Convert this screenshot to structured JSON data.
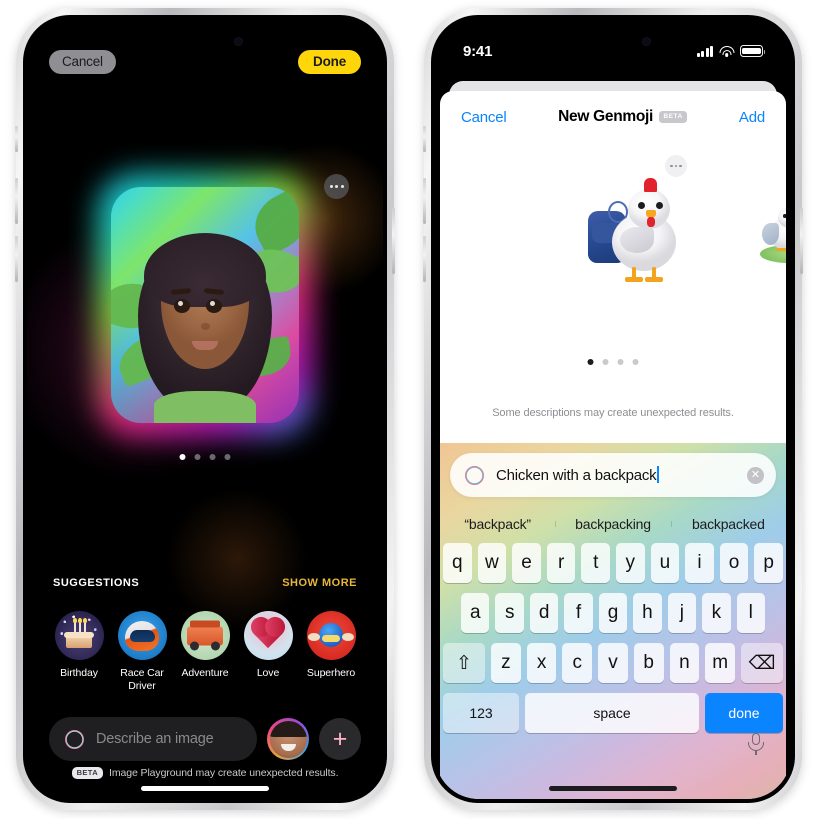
{
  "left_phone": {
    "app": "Image Playground",
    "topbar": {
      "cancel_label": "Cancel",
      "done_label": "Done"
    },
    "more_options_icon": "ellipsis-icon",
    "carousel": {
      "pages": 4,
      "active_index": 0
    },
    "suggestions": {
      "header_label": "SUGGESTIONS",
      "show_more_label": "SHOW MORE",
      "items": [
        {
          "label": "Birthday",
          "icon": "birthday-cake-icon"
        },
        {
          "label": "Race Car Driver",
          "icon": "racing-helmet-icon"
        },
        {
          "label": "Adventure",
          "icon": "offroad-truck-icon"
        },
        {
          "label": "Love",
          "icon": "heart-icon"
        },
        {
          "label": "Superhero",
          "icon": "superhero-icon"
        }
      ]
    },
    "compose": {
      "placeholder": "Describe an image",
      "value": "",
      "sparkle_icon": "image-playground-icon",
      "avatar_icon": "person-avatar",
      "add_label": "+"
    },
    "footer": {
      "beta_badge": "BETA",
      "disclaimer": "Image Playground may create unexpected results."
    }
  },
  "right_phone": {
    "statusbar": {
      "time": "9:41",
      "cellular_icon": "signal-bars-icon",
      "wifi_icon": "wifi-icon",
      "battery_icon": "battery-icon"
    },
    "nav": {
      "cancel_label": "Cancel",
      "title": "New Genmoji",
      "beta_badge": "BETA",
      "add_label": "Add"
    },
    "canvas": {
      "more_options_icon": "ellipsis-icon",
      "main_result_icon": "chicken-with-backpack-genmoji",
      "next_result_icon": "chicken-on-grass-genmoji",
      "pages": 4,
      "active_index": 0
    },
    "hint": "Some descriptions may create unexpected results.",
    "input": {
      "sparkle_icon": "genmoji-icon",
      "value": "Chicken with a backpack",
      "clear_icon": "clear-text-icon"
    },
    "predictions": [
      "“backpack”",
      "backpacking",
      "backpacked"
    ],
    "keyboard": {
      "row1": [
        "q",
        "w",
        "e",
        "r",
        "t",
        "y",
        "u",
        "i",
        "o",
        "p"
      ],
      "row2": [
        "a",
        "s",
        "d",
        "f",
        "g",
        "h",
        "j",
        "k",
        "l"
      ],
      "row3_shift": "⇧",
      "row3": [
        "z",
        "x",
        "c",
        "v",
        "b",
        "n",
        "m"
      ],
      "row3_delete": "⌫",
      "numbers_label": "123",
      "space_label": "space",
      "done_label": "done",
      "mic_icon": "microphone-icon"
    }
  },
  "colors": {
    "accent_yellow": "#ffd60a",
    "accent_blue": "#0a84ff",
    "show_more_gold": "#e8b73c",
    "dark_bg": "#000000",
    "sheet_white": "#ffffff"
  }
}
